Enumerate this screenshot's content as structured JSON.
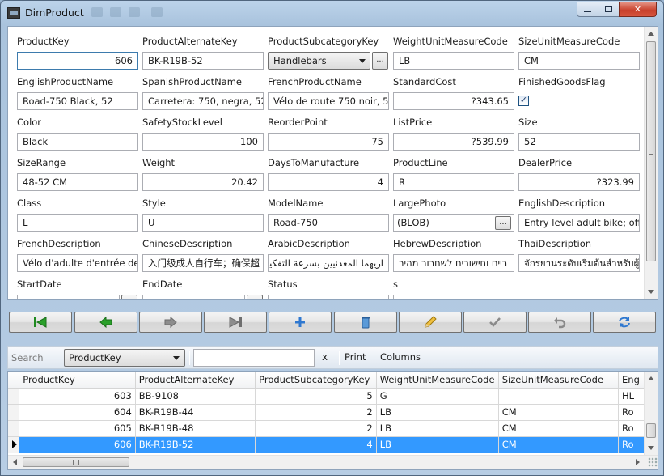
{
  "window": {
    "title": "DimProduct"
  },
  "form": {
    "product_key": {
      "label": "ProductKey",
      "value": "606"
    },
    "product_alternate_key": {
      "label": "ProductAlternateKey",
      "value": "BK-R19B-52"
    },
    "product_subcategory_key": {
      "label": "ProductSubcategoryKey",
      "value": "Handlebars",
      "button": "..."
    },
    "weight_unit_measure_code": {
      "label": "WeightUnitMeasureCode",
      "value": "LB"
    },
    "size_unit_measure_code": {
      "label": "SizeUnitMeasureCode",
      "value": "CM"
    },
    "english_product_name": {
      "label": "EnglishProductName",
      "value": "Road-750 Black, 52"
    },
    "spanish_product_name": {
      "label": "SpanishProductName",
      "value": "Carretera: 750, negra, 52"
    },
    "french_product_name": {
      "label": "FrenchProductName",
      "value": "Vélo de route 750 noir, 52"
    },
    "standard_cost": {
      "label": "StandardCost",
      "value": "?343.65"
    },
    "finished_goods_flag": {
      "label": "FinishedGoodsFlag",
      "checked": true,
      "mark": "✓"
    },
    "color": {
      "label": "Color",
      "value": "Black"
    },
    "safety_stock_level": {
      "label": "SafetyStockLevel",
      "value": "100"
    },
    "reorder_point": {
      "label": "ReorderPoint",
      "value": "75"
    },
    "list_price": {
      "label": "ListPrice",
      "value": "?539.99"
    },
    "size": {
      "label": "Size",
      "value": "52"
    },
    "size_range": {
      "label": "SizeRange",
      "value": "48-52 CM"
    },
    "weight": {
      "label": "Weight",
      "value": "20.42"
    },
    "days_to_manufacture": {
      "label": "DaysToManufacture",
      "value": "4"
    },
    "product_line": {
      "label": "ProductLine",
      "value": "R"
    },
    "dealer_price": {
      "label": "DealerPrice",
      "value": "?323.99"
    },
    "class": {
      "label": "Class",
      "value": "L"
    },
    "style": {
      "label": "Style",
      "value": "U"
    },
    "model_name": {
      "label": "ModelName",
      "value": "Road-750"
    },
    "large_photo": {
      "label": "LargePhoto",
      "value": "(BLOB)",
      "button": "..."
    },
    "english_description": {
      "label": "EnglishDescription",
      "value": "Entry level adult bike; offer"
    },
    "french_description": {
      "label": "FrenchDescription",
      "value": "Vélo d'adulte d'entrée de g"
    },
    "chinese_description": {
      "label": "ChineseDescription",
      "value": "入门级成人自行车；确保超"
    },
    "arabic_description": {
      "label": "ArabicDescription",
      "value": "اريهما المعدنيين بسرعة التفكيك"
    },
    "hebrew_description": {
      "label": "HebrewDescription",
      "value": "ריים וחישורים לשחרור מהיר"
    },
    "thai_description": {
      "label": "ThaiDescription",
      "value": "จักรยานระดับเริ่มต้นสำหรับผู้ใ"
    },
    "start_date": {
      "label": "StartDate"
    },
    "end_date": {
      "label": "EndDate"
    },
    "status": {
      "label": "Status"
    },
    "s_field": {
      "label": "s"
    }
  },
  "search": {
    "label": "Search",
    "column": "ProductKey",
    "clear": "x",
    "print": "Print",
    "columns": "Columns"
  },
  "grid": {
    "headers": [
      "ProductKey",
      "ProductAlternateKey",
      "ProductSubcategoryKey",
      "WeightUnitMeasureCode",
      "SizeUnitMeasureCode",
      "Eng"
    ],
    "rows": [
      [
        "603",
        "BB-9108",
        "5",
        "G",
        "",
        "HL"
      ],
      [
        "604",
        "BK-R19B-44",
        "2",
        "LB",
        "CM",
        "Ro"
      ],
      [
        "605",
        "BK-R19B-48",
        "2",
        "LB",
        "CM",
        "Ro"
      ],
      [
        "606",
        "BK-R19B-52",
        "4",
        "LB",
        "CM",
        "Ro"
      ]
    ],
    "selected_row": 3,
    "scroll_grip": "III"
  },
  "colors": {
    "selection": "#3399ff",
    "close_button": "#c8402b",
    "nav_green": "#2aa02a"
  },
  "icons": {
    "nav": [
      "first-icon",
      "previous-icon",
      "next-icon",
      "last-icon",
      "add-icon",
      "delete-icon",
      "edit-icon",
      "save-icon",
      "undo-icon",
      "refresh-icon"
    ]
  }
}
